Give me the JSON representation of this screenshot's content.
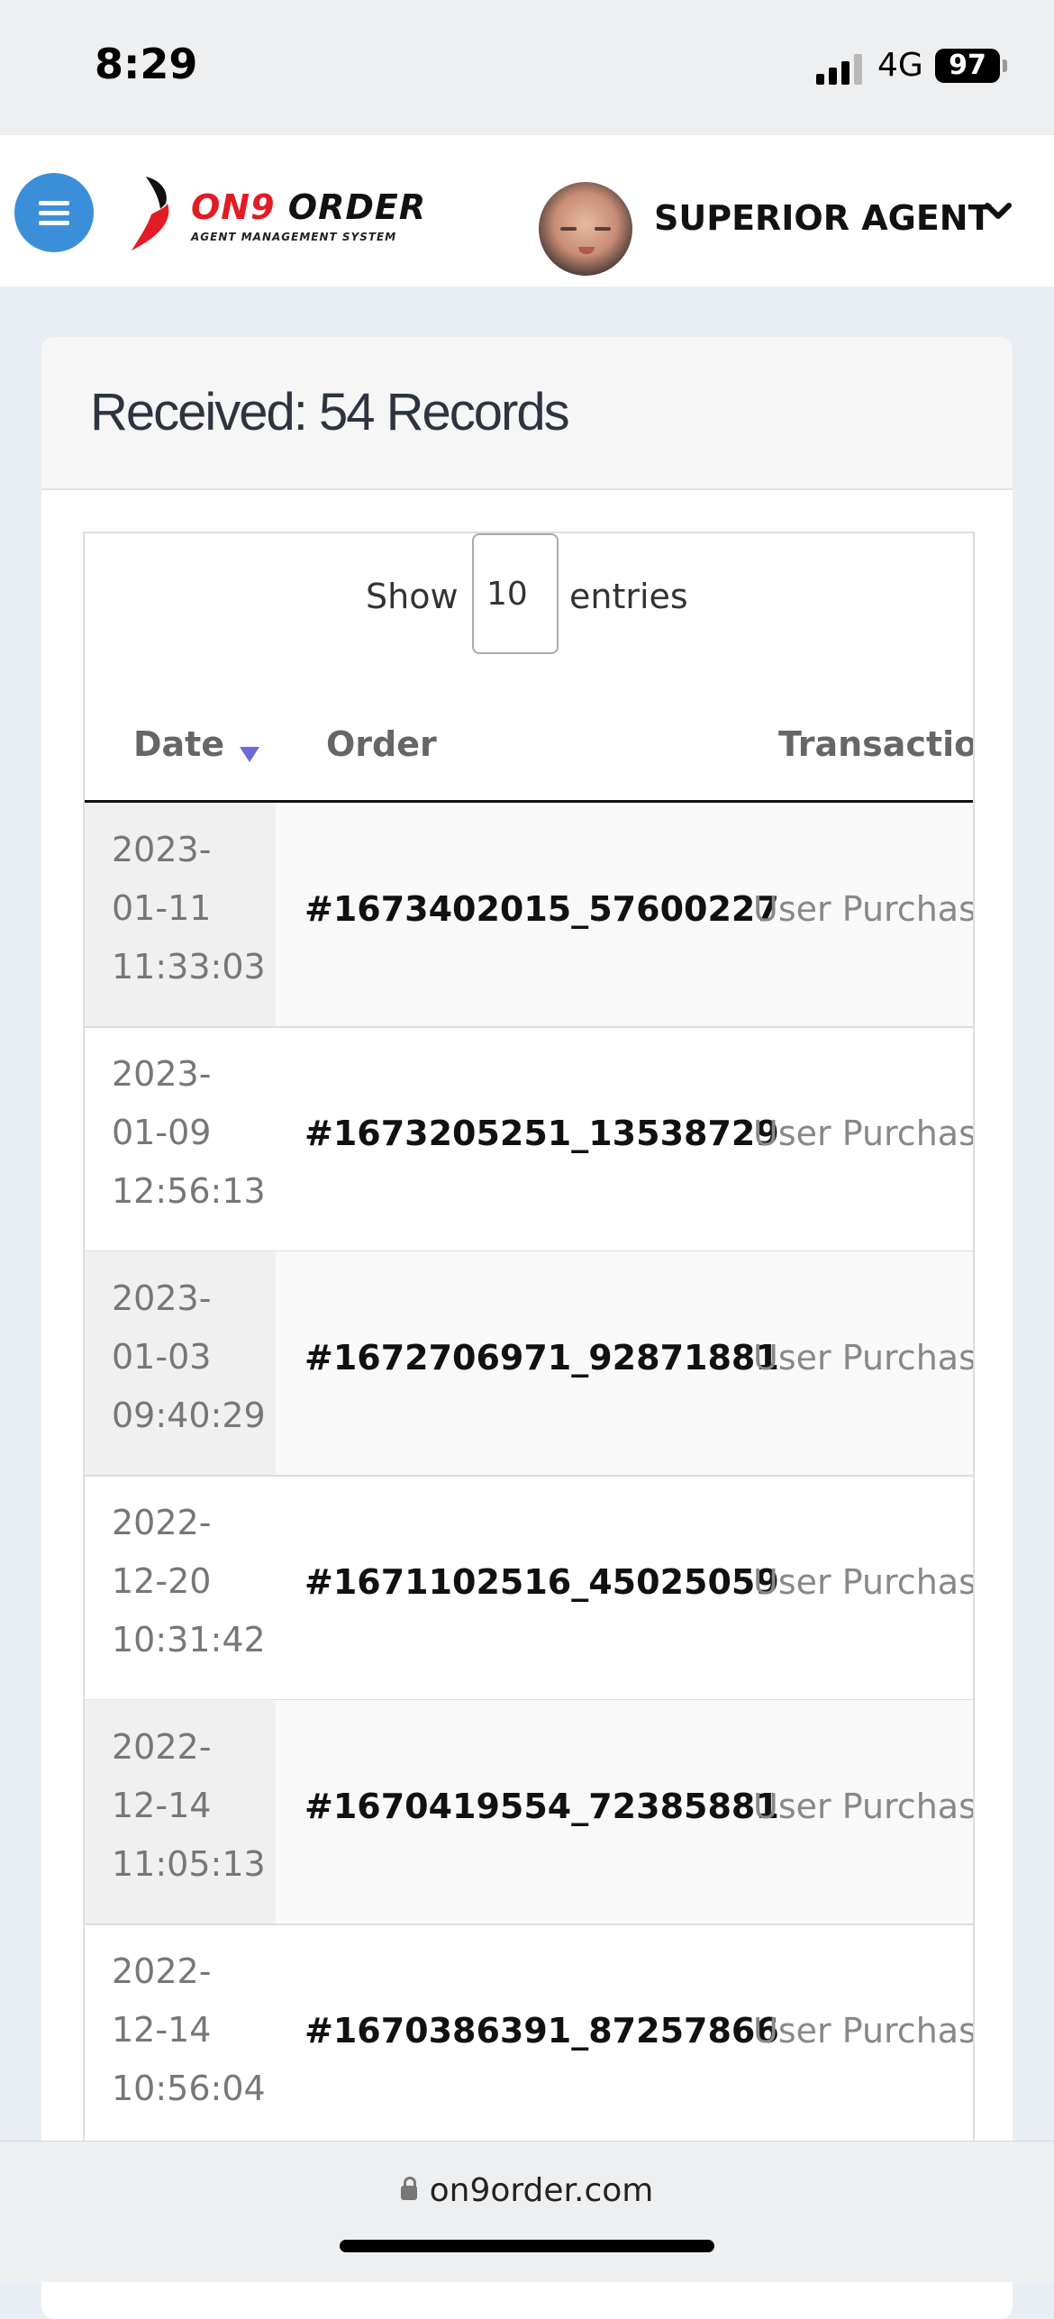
{
  "status_bar": {
    "time": "8:29",
    "network": "4G",
    "battery": "97"
  },
  "header": {
    "logo_name_red": "ON9",
    "logo_name_dark": " ORDER",
    "logo_tagline": "AGENT MANAGEMENT SYSTEM",
    "user_name": "SUPERIOR AGENT"
  },
  "card": {
    "title": "Received: 54 Records",
    "length_label": "Show",
    "length_value": "10",
    "length_suffix": "entries",
    "columns": [
      "Date",
      "Order",
      "Transaction"
    ],
    "rows": [
      {
        "date": [
          "2023-",
          "01-11",
          "11:33:03"
        ],
        "order": "#1673402015_57600227",
        "transaction": "User Purchase"
      },
      {
        "date": [
          "2023-",
          "01-09",
          "12:56:13"
        ],
        "order": "#1673205251_13538729",
        "transaction": "User Purchase"
      },
      {
        "date": [
          "2023-",
          "01-03",
          "09:40:29"
        ],
        "order": "#1672706971_92871881",
        "transaction": "User Purchase"
      },
      {
        "date": [
          "2022-",
          "12-20",
          "10:31:42"
        ],
        "order": "#1671102516_45025059",
        "transaction": "User Purchase"
      },
      {
        "date": [
          "2022-",
          "12-14",
          "11:05:13"
        ],
        "order": "#1670419554_72385881",
        "transaction": "User Purchase"
      },
      {
        "date": [
          "2022-",
          "12-14",
          "10:56:04"
        ],
        "order": "#1670386391_87257866",
        "transaction": "User Purchase"
      }
    ]
  },
  "browser": {
    "url": "on9order.com"
  },
  "colors": {
    "brand_red": "#e21b24",
    "menu_blue": "#3b8fd9",
    "sort_arrow": "#6a6ad8"
  }
}
